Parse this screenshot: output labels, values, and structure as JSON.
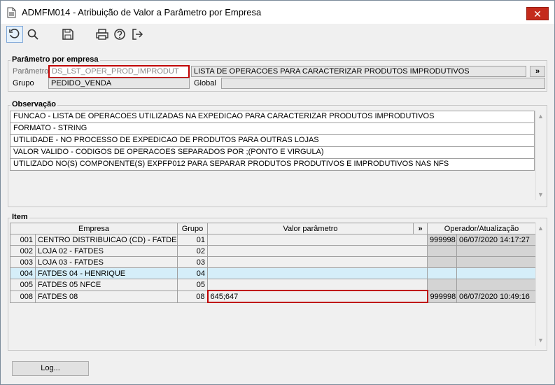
{
  "window": {
    "title": "ADMFM014 - Atribuição de Valor a Parâmetro por Empresa",
    "close_glyph": "✕"
  },
  "toolbar": {
    "icons": [
      "refresh-icon",
      "search-icon",
      "save-icon",
      "print-icon",
      "help-icon",
      "exit-icon"
    ]
  },
  "param_section": {
    "title": "Parâmetro por empresa",
    "parametro_label": "Parâmetro",
    "parametro_value": "DS_LST_OPER_PROD_IMPRODUT",
    "parametro_desc": "LISTA DE OPERACOES PARA CARACTERIZAR PRODUTOS IMPRODUTIVOS",
    "more_button": "»",
    "grupo_label": "Grupo",
    "grupo_value": "PEDIDO_VENDA",
    "global_label": "Global",
    "global_value": ""
  },
  "obs_section": {
    "title": "Observação",
    "lines": [
      "FUNCAO - LISTA DE OPERACOES UTILIZADAS NA EXPEDICAO PARA CARACTERIZAR PRODUTOS IMPRODUTIVOS",
      "FORMATO - STRING",
      "UTILIDADE - NO PROCESSO DE EXPEDICAO DE PRODUTOS PARA OUTRAS LOJAS",
      "VALOR VALIDO - CODIGOS DE OPERACOES SEPARADOS POR ;(PONTO E VIRGULA)",
      "UTILIZADO NO(S) COMPONENTE(S) EXPFP012  PARA SEPARAR PRODUTOS PRODUTIVOS E IMPRODUTIVOS NAS NFS"
    ]
  },
  "item_section": {
    "title": "Item",
    "headers": {
      "empresa": "Empresa",
      "grupo": "Grupo",
      "valor": "Valor parâmetro",
      "more": "»",
      "operador": "Operador/Atualização"
    },
    "rows": [
      {
        "code": "001",
        "empresa": "CENTRO DISTRIBUICAO (CD) - FATDES",
        "grupo": "01",
        "valor": "",
        "operador": "999998",
        "data": "06/07/2020 14:17:27"
      },
      {
        "code": "002",
        "empresa": "LOJA 02 - FATDES",
        "grupo": "02",
        "valor": "",
        "operador": "",
        "data": ""
      },
      {
        "code": "003",
        "empresa": "LOJA 03 - FATDES",
        "grupo": "03",
        "valor": "",
        "operador": "",
        "data": ""
      },
      {
        "code": "004",
        "empresa": "FATDES 04 - HENRIQUE",
        "grupo": "04",
        "valor": "",
        "operador": "",
        "data": ""
      },
      {
        "code": "005",
        "empresa": "FATDES 05 NFCE",
        "grupo": "05",
        "valor": "",
        "operador": "",
        "data": ""
      },
      {
        "code": "008",
        "empresa": "FATDES 08",
        "grupo": "08",
        "valor": "645;647",
        "operador": "999998",
        "data": "06/07/2020 10:49:16"
      }
    ]
  },
  "footer": {
    "log_button": "Log..."
  }
}
